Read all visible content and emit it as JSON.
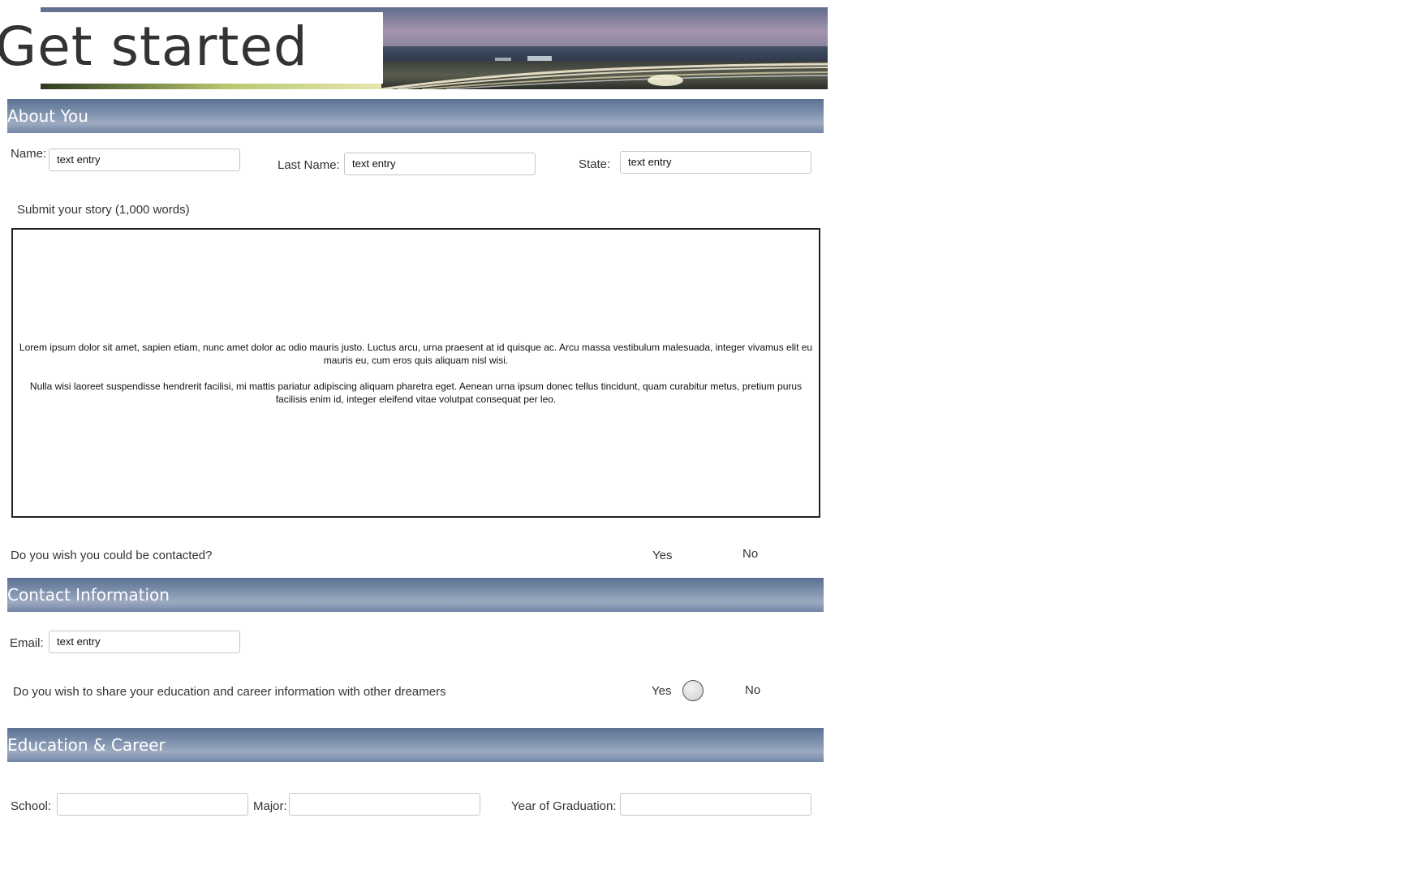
{
  "header": {
    "title": "Get started"
  },
  "sections": {
    "about": "About You",
    "contact": "Contact Information",
    "education": "Education & Career"
  },
  "about": {
    "name_label": "Name:",
    "name_value": "text entry",
    "last_name_label": "Last Name:",
    "last_name_value": "text entry",
    "state_label": "State:",
    "state_value": "text entry",
    "story_label": "Submit your story (1,000 words)",
    "story_paragraph_1": "Lorem ipsum dolor sit amet, sapien etiam, nunc amet dolor ac odio mauris justo. Luctus arcu, urna praesent at id quisque ac. Arcu massa vestibulum malesuada, integer vivamus elit eu mauris eu, cum eros quis aliquam nisl wisi.",
    "story_paragraph_2": "Nulla wisi laoreet suspendisse hendrerit facilisi, mi mattis pariatur adipiscing aliquam pharetra eget. Aenean urna ipsum donec tellus tincidunt, quam curabitur metus, pretium purus facilisis enim id, integer eleifend vitae volutpat consequat per leo.",
    "contact_question": "Do you wish you could be contacted?",
    "yes_label": "Yes",
    "no_label": "No"
  },
  "contact": {
    "email_label": "Email:",
    "email_value": "text entry",
    "share_question": "Do you wish to share your education and career information with other dreamers",
    "yes_label": "Yes",
    "no_label": "No"
  },
  "education": {
    "school_label": "School:",
    "school_value": "",
    "major_label": "Major:",
    "major_value": "",
    "year_label": "Year of Graduation:",
    "year_value": ""
  },
  "colors": {
    "section_header": "#7186a6",
    "section_text": "#ffffff",
    "title_text": "#333333"
  },
  "icons": {
    "share_yes_radio": "radio-button-icon"
  }
}
